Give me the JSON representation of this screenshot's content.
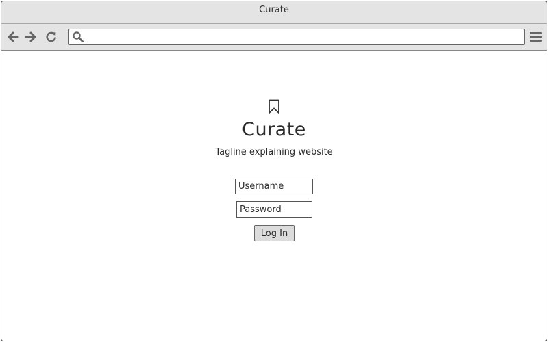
{
  "window": {
    "title": "Curate"
  },
  "toolbar": {
    "back_icon": "arrow-left-icon",
    "forward_icon": "arrow-right-icon",
    "reload_icon": "reload-icon",
    "search_icon": "search-icon",
    "menu_icon": "hamburger-menu-icon",
    "address_value": ""
  },
  "page": {
    "logo_icon": "bookmark-icon",
    "title": "Curate",
    "tagline": "Tagline explaining website",
    "username_placeholder": "Username",
    "password_placeholder": "Password",
    "login_label": "Log In"
  },
  "colors": {
    "chrome_background": "#e4e4e4",
    "border": "#555555",
    "text": "#2b2b2b",
    "button_background": "#dcdcdc"
  }
}
